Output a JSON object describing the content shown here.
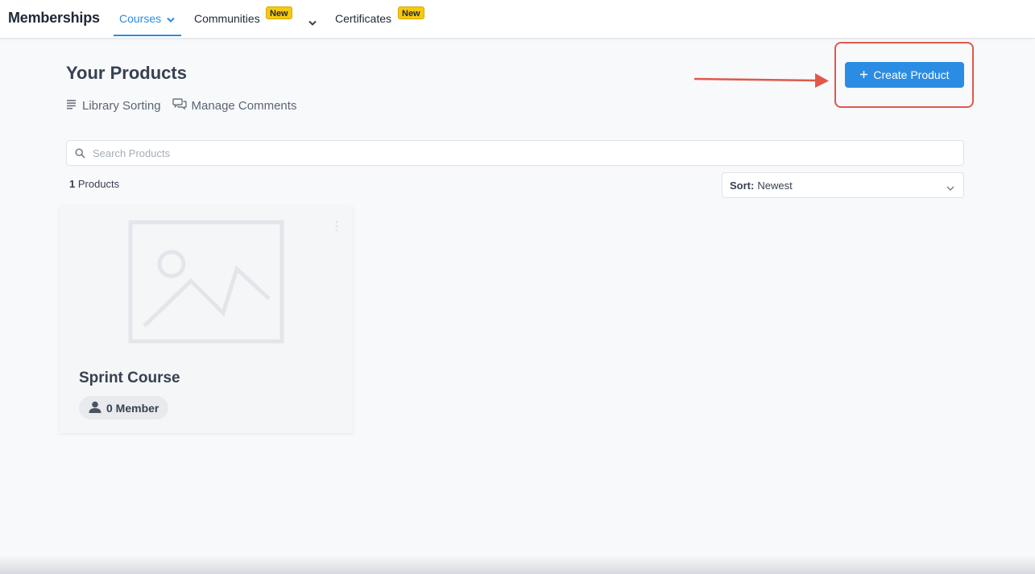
{
  "header": {
    "brand": "Memberships",
    "nav": [
      {
        "label": "Courses",
        "active": true
      },
      {
        "label": "Communities",
        "badge": "New"
      },
      {
        "label": "Certificates",
        "badge": "New"
      }
    ]
  },
  "page": {
    "title": "Your Products",
    "links": [
      "Library Sorting",
      "Manage Comments"
    ],
    "create_button": "Create Product"
  },
  "search": {
    "placeholder": "Search Products",
    "value": ""
  },
  "results": {
    "count": "1",
    "count_suffix": "Products"
  },
  "sort": {
    "label": "Sort:",
    "value": "Newest"
  },
  "products": [
    {
      "title": "Sprint Course",
      "members": "0 Member"
    }
  ],
  "colors": {
    "accent": "#2b8ce4",
    "badge": "#f6c90e",
    "highlight": "#e0584a"
  },
  "icons": [
    "chevron-down-icon",
    "list-icon",
    "comments-icon",
    "plus-icon",
    "search-icon",
    "kebab-menu-icon",
    "image-placeholder-icon",
    "user-icon",
    "arrow-annotation-icon"
  ]
}
